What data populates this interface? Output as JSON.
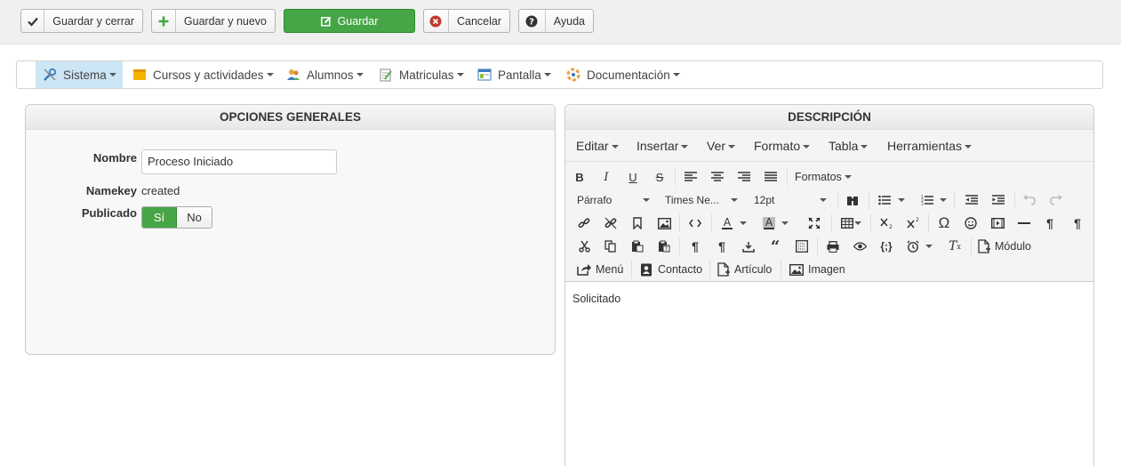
{
  "toolbar": {
    "save_close": "Guardar y cerrar",
    "save_new": "Guardar y nuevo",
    "save": "Guardar",
    "cancel": "Cancelar",
    "help": "Ayuda"
  },
  "nav": {
    "items": [
      {
        "label": "Sistema"
      },
      {
        "label": "Cursos y actividades"
      },
      {
        "label": "Alumnos"
      },
      {
        "label": "Matriculas"
      },
      {
        "label": "Pantalla"
      },
      {
        "label": "Documentación"
      }
    ]
  },
  "general": {
    "title": "OPCIONES GENERALES",
    "name_label": "Nombre",
    "name_value": "Proceso Iniciado",
    "namekey_label": "Namekey",
    "namekey_value": "created",
    "published_label": "Publicado",
    "yes": "Sí",
    "no": "No"
  },
  "description": {
    "title": "DESCRIPCIÓN",
    "menus": [
      "Editar",
      "Insertar",
      "Ver",
      "Formato",
      "Tabla",
      "Herramientas"
    ],
    "formats_label": "Formatos",
    "block_format": "Párrafo",
    "font_family": "Times Ne...",
    "font_size": "12pt",
    "module_button": "Módulo",
    "menu_button": "Menú",
    "contact_button": "Contacto",
    "article_button": "Artículo",
    "image_button": "Imagen",
    "content": "Solicitado"
  },
  "colors": {
    "primary_green": "#46a546",
    "active_nav": "#cde6f5",
    "cancel_red": "#c0392b"
  }
}
